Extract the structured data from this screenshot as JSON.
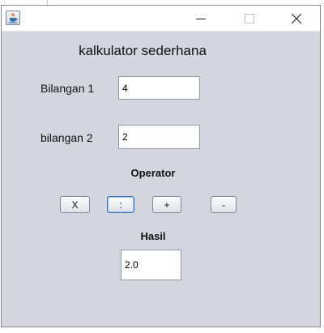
{
  "window": {
    "title": "",
    "icon": "java-cup-icon",
    "controls": [
      "minimize-icon",
      "maximize-icon",
      "close-icon"
    ]
  },
  "form": {
    "heading": "kalkulator sederhana",
    "bilangan1": {
      "label": "Bilangan 1",
      "value": "4"
    },
    "bilangan2": {
      "label": "bilangan 2",
      "value": "2"
    },
    "operator_label": "Operator",
    "operators": [
      "X",
      ":",
      "+",
      "-"
    ],
    "result_label": "Hasil",
    "result_value": "2.0"
  },
  "colors": {
    "panel_bg": "#d3d6de",
    "focused_button_border": "#3e74b0"
  }
}
